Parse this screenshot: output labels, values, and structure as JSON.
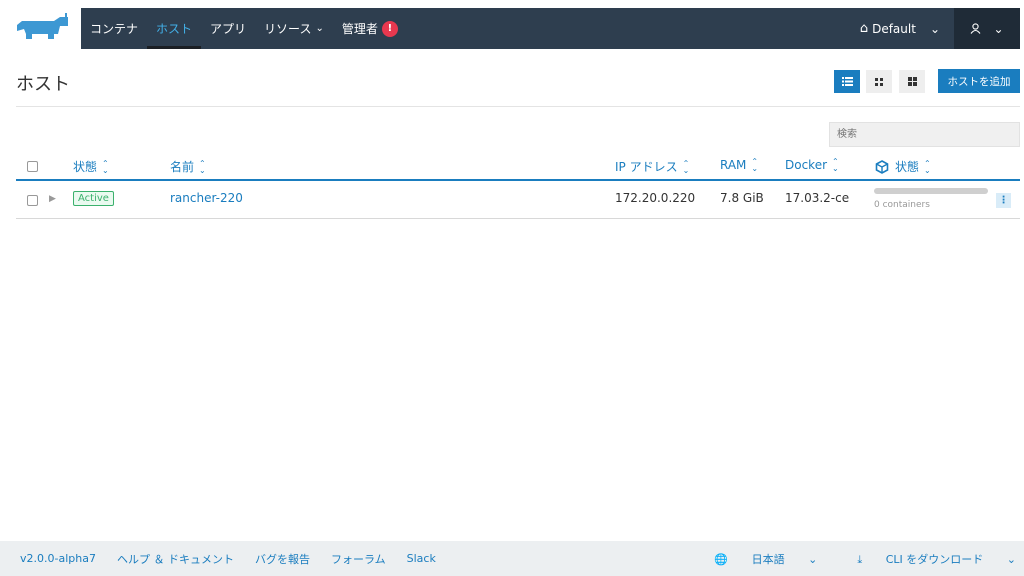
{
  "brand": {
    "logo_icon": "rancher-cow-logo",
    "accent": "#1a7dbf",
    "nav_bg": "#2e3e4f"
  },
  "nav": {
    "items": [
      {
        "label": "コンテナ"
      },
      {
        "label": "ホスト",
        "active": true
      },
      {
        "label": "アプリ"
      },
      {
        "label": "リソース",
        "has_dropdown": true
      },
      {
        "label": "管理者",
        "badge": "!"
      }
    ],
    "environment": "Default",
    "user_icon": "user-icon"
  },
  "page": {
    "title": "ホスト",
    "add_button": "ホストを追加",
    "search_placeholder": "検索",
    "view_modes": [
      "list-view-icon",
      "grid-small-icon",
      "grid-large-icon"
    ]
  },
  "table": {
    "headers": {
      "state": "状態",
      "name": "名前",
      "ip": "IP アドレス",
      "ram": "RAM",
      "docker": "Docker",
      "container_state": "状態"
    },
    "rows": [
      {
        "state": "Active",
        "name": "rancher-220",
        "ip": "172.20.0.220",
        "ram": "7.8 GiB",
        "docker": "17.03.2-ce",
        "containers": "0 containers",
        "container_fill": 0
      }
    ]
  },
  "footer": {
    "version": "v2.0.0-alpha7",
    "help": "ヘルプ ＆ ドキュメント",
    "report": "バグを報告",
    "forum": "フォーラム",
    "slack": "Slack",
    "language": "日本語",
    "cli": "CLI をダウンロード"
  }
}
